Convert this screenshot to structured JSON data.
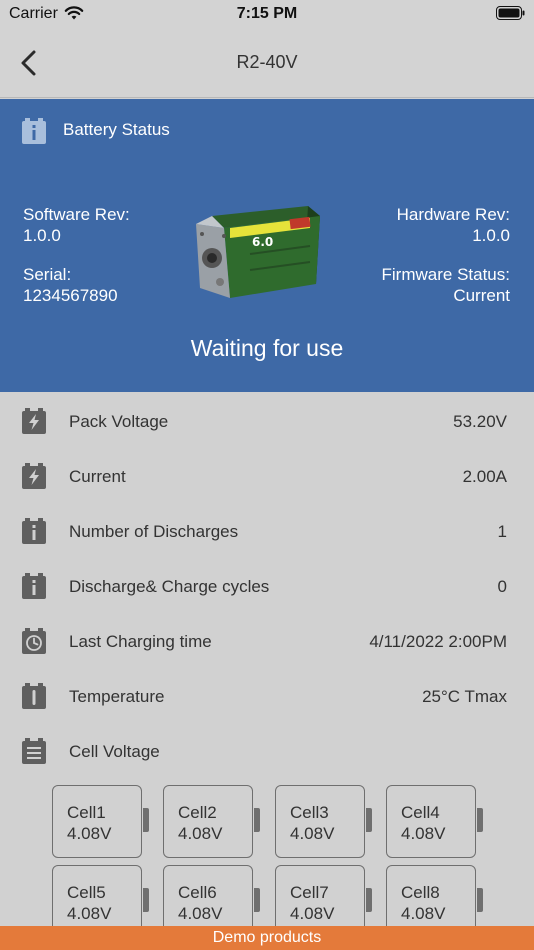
{
  "status_bar": {
    "carrier": "Carrier",
    "time": "7:15 PM"
  },
  "nav": {
    "title": "R2-40V"
  },
  "battery_status": {
    "header": "Battery Status",
    "software_rev_label": "Software Rev:",
    "software_rev": "1.0.0",
    "serial_label": "Serial:",
    "serial": "1234567890",
    "hardware_rev_label": "Hardware Rev:",
    "hardware_rev": "1.0.0",
    "firmware_status_label": "Firmware Status:",
    "firmware_status": "Current",
    "state": "Waiting for use"
  },
  "rows": [
    {
      "icon": "battery-bolt-icon",
      "label": "Pack Voltage",
      "value": "53.20V"
    },
    {
      "icon": "battery-bolt-icon",
      "label": "Current",
      "value": "2.00A"
    },
    {
      "icon": "battery-info-icon",
      "label": "Number of Discharges",
      "value": "1"
    },
    {
      "icon": "battery-info-icon",
      "label": "Discharge& Charge cycles",
      "value": "0"
    },
    {
      "icon": "clock-icon",
      "label": "Last Charging time",
      "value": "4/11/2022 2:00PM"
    },
    {
      "icon": "thermometer-icon",
      "label": "Temperature",
      "value": "25°C Tmax"
    },
    {
      "icon": "list-icon",
      "label": "Cell Voltage",
      "value": ""
    }
  ],
  "cells": [
    {
      "name": "Cell1",
      "voltage": "4.08V"
    },
    {
      "name": "Cell2",
      "voltage": "4.08V"
    },
    {
      "name": "Cell3",
      "voltage": "4.08V"
    },
    {
      "name": "Cell4",
      "voltage": "4.08V"
    },
    {
      "name": "Cell5",
      "voltage": "4.08V"
    },
    {
      "name": "Cell6",
      "voltage": "4.08V"
    },
    {
      "name": "Cell7",
      "voltage": "4.08V"
    },
    {
      "name": "Cell8",
      "voltage": "4.08V"
    }
  ],
  "footer": {
    "text": "Demo products"
  },
  "colors": {
    "header_blue": "#3e69a6",
    "footer_orange": "#e47a3a",
    "background": "#d1d1d1"
  }
}
